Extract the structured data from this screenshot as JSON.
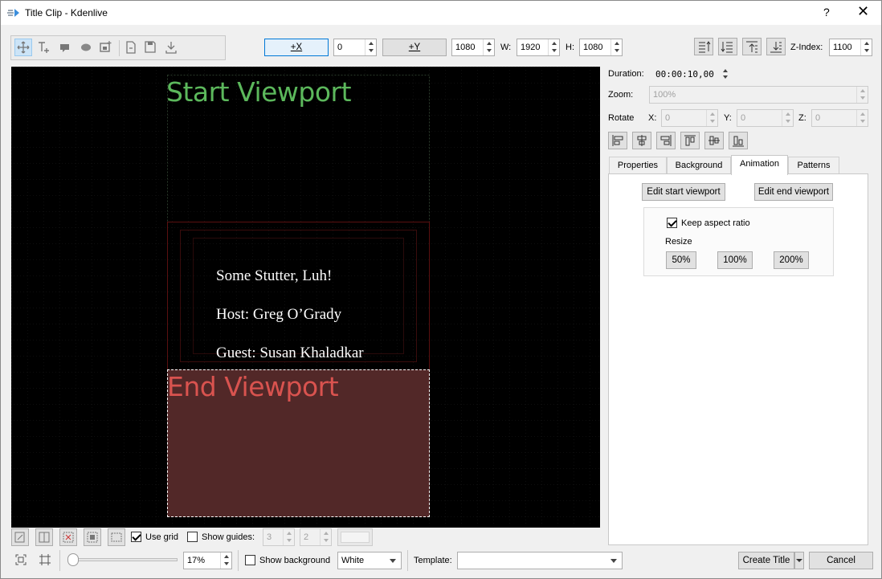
{
  "window": {
    "title": "Title Clip - Kdenlive",
    "help_label": "?",
    "close_label": "✕"
  },
  "toolbar": {
    "x_button": "+X",
    "x_value": "0",
    "y_button": "+Y",
    "y_value": "1080",
    "w_label": "W:",
    "w_value": "1920",
    "h_label": "H:",
    "h_value": "1080",
    "zindex_label": "Z-Index:",
    "zindex_value": "1100"
  },
  "canvas": {
    "start_viewport": "Start Viewport",
    "end_viewport": "End Viewport",
    "lines": [
      "Some Stutter, Luh!",
      "Host: Greg O’Grady",
      "Guest: Susan Khaladkar"
    ]
  },
  "properties": {
    "duration_label": "Duration:",
    "duration_value": "00:00:10,00",
    "zoom_label": "Zoom:",
    "zoom_value": "100%",
    "rotate_label": "Rotate",
    "x_label": "X:",
    "x_value": "0",
    "y_label": "Y:",
    "y_value": "0",
    "z_label": "Z:",
    "z_value": "0"
  },
  "tabs": [
    "Properties",
    "Background",
    "Animation",
    "Patterns"
  ],
  "animation": {
    "edit_start": "Edit start viewport",
    "edit_end": "Edit end viewport",
    "keep_aspect": "Keep aspect ratio",
    "resize_label": "Resize",
    "resize_options": [
      "50%",
      "100%",
      "200%"
    ]
  },
  "bottom": {
    "use_grid": "Use grid",
    "show_guides": "Show guides:",
    "guides_h": "3",
    "guides_v": "2",
    "zoom_value": "17%",
    "show_background": "Show background",
    "background_color": "White",
    "template_label": "Template:",
    "template_value": "",
    "create_title": "Create Title",
    "cancel": "Cancel"
  },
  "colors": {
    "start_viewport": "#5cb85c",
    "end_viewport": "#d9534f",
    "end_fill": "#522828",
    "canvas_bg": "#000000",
    "accent": "#0078d7"
  }
}
